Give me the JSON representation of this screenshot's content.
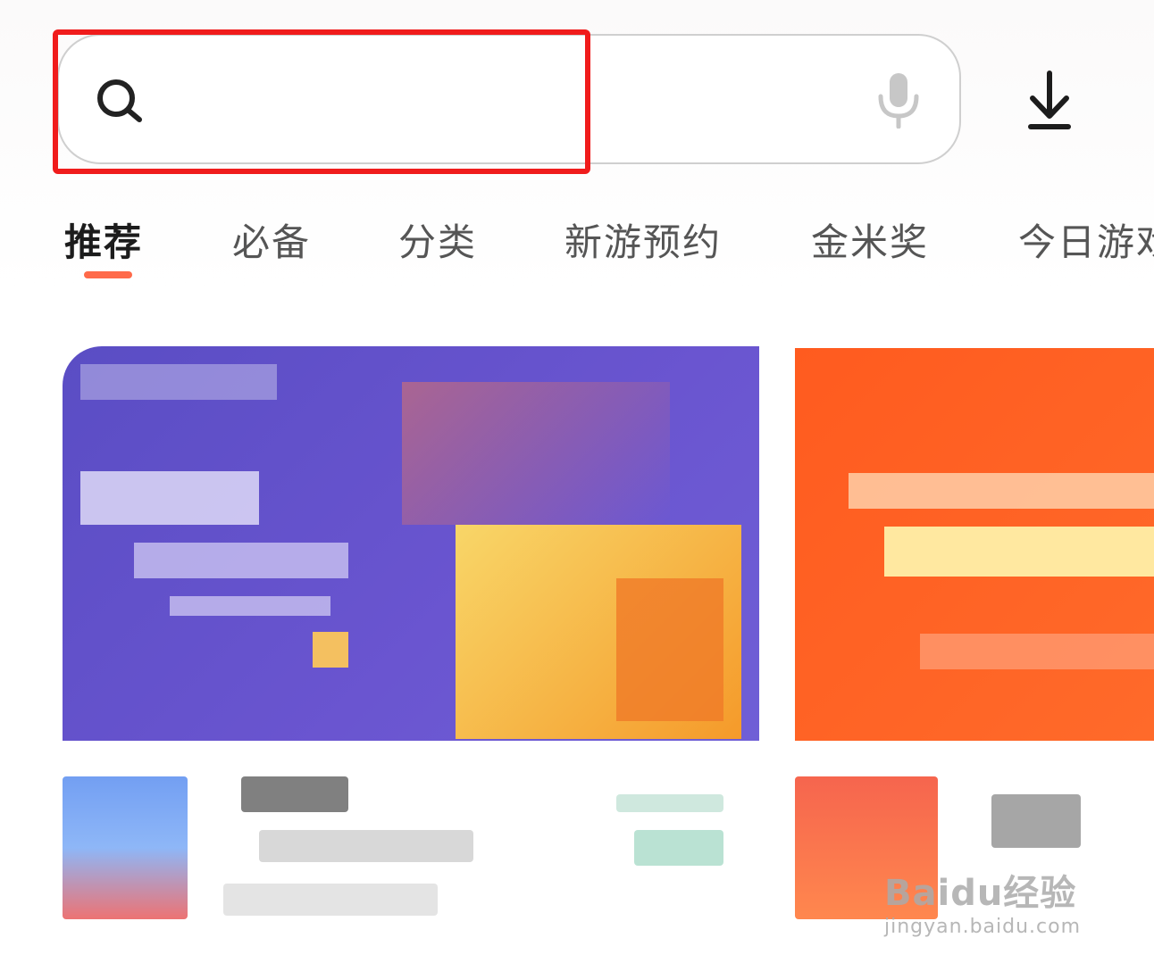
{
  "search": {
    "placeholder": ""
  },
  "tabs": [
    {
      "label": "推荐",
      "active": true
    },
    {
      "label": "必备",
      "active": false
    },
    {
      "label": "分类",
      "active": false
    },
    {
      "label": "新游预约",
      "active": false
    },
    {
      "label": "金米奖",
      "active": false
    },
    {
      "label": "今日游戏",
      "active": false
    }
  ],
  "icons": {
    "search": "search-icon",
    "mic": "microphone-icon",
    "download": "download-icon"
  },
  "colors": {
    "highlight": "#f01c1c",
    "tab_indicator": "#ff6a4a",
    "banner_purple": "#5a4dc4",
    "banner_orange": "#ff5b1f"
  },
  "watermark": {
    "main": "Baidu经验",
    "sub": "jingyan.baidu.com"
  }
}
